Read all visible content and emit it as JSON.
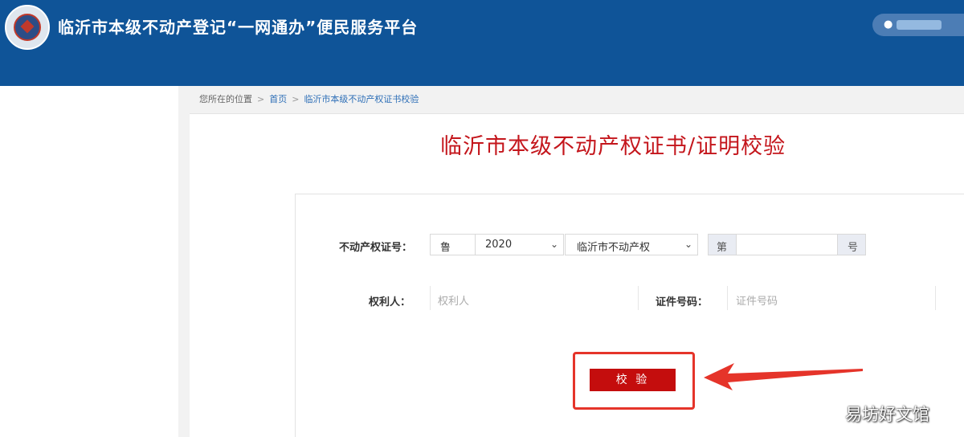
{
  "header": {
    "site_title": "临沂市本级不动产登记“一网通办”便民服务平台",
    "brand_color": "#0f5498",
    "user_icon": "user-icon"
  },
  "breadcrumb": {
    "prefix": "您所在的位置",
    "home": "首页",
    "current": "临沂市本级不动产权证书校验"
  },
  "page": {
    "heading": "临沂市本级不动产权证书/证明校验",
    "heading_color": "#c4161c"
  },
  "form": {
    "cert_no_label": "不动产权证号：",
    "province_prefix": "鲁",
    "year_value": "2020",
    "office_value": "临沂市不动产权",
    "di_addon": "第",
    "hao_addon": "号",
    "rights_holder_label": "权利人：",
    "rights_holder_placeholder": "权利人",
    "id_no_label": "证件号码：",
    "id_no_placeholder": "证件号码",
    "verify_button": "校 验",
    "button_color": "#c40d0d"
  },
  "watermark": "易坊好文馆"
}
